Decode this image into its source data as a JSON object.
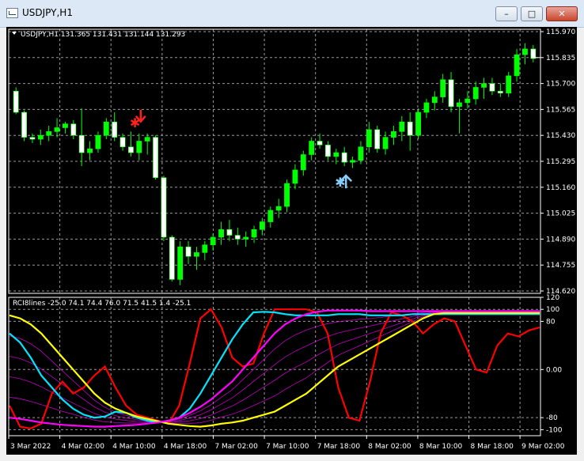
{
  "window": {
    "title": "USDJPY,H1",
    "minimize_icon": "minimize-icon",
    "maximize_icon": "maximize-icon",
    "close_icon": "close-icon"
  },
  "main_chart": {
    "header": "USDJPY,H1  131.365 131.431 131.144 131.293",
    "price_labels": [
      "115.970",
      "115.835",
      "115.700",
      "115.565",
      "115.430",
      "115.295",
      "115.160",
      "115.025",
      "114.890",
      "114.755",
      "114.620"
    ],
    "current_price": "115.835",
    "up_color": "#00ff00",
    "down_color": "#ffffff",
    "sell_arrow_color": "#ff2020",
    "buy_arrow_color": "#87cefa"
  },
  "sub_chart": {
    "header": "RCI8lines -25.0 74.1 74.4 76.0 71.5 41.5 1.4 -25.1",
    "level_labels": [
      "120",
      "100",
      "80",
      "0.00",
      "-80",
      "-100"
    ]
  },
  "time_labels": [
    "3 Mar 2022",
    "4 Mar 02:00",
    "4 Mar 10:00",
    "4 Mar 18:00",
    "7 Mar 02:00",
    "7 Mar 10:00",
    "7 Mar 18:00",
    "8 Mar 02:00",
    "8 Mar 10:00",
    "8 Mar 18:00",
    "9 Mar 02:00"
  ],
  "chart_data": {
    "type": "candlestick",
    "symbol": "USDJPY",
    "timeframe": "H1",
    "price_range": [
      114.62,
      115.97
    ],
    "candles": [
      [
        115.66,
        115.68,
        115.54,
        115.55
      ],
      [
        115.55,
        115.56,
        115.4,
        115.42
      ],
      [
        115.42,
        115.44,
        115.39,
        115.41
      ],
      [
        115.41,
        115.46,
        115.38,
        115.43
      ],
      [
        115.43,
        115.48,
        115.4,
        115.45
      ],
      [
        115.45,
        115.52,
        115.42,
        115.47
      ],
      [
        115.47,
        115.5,
        115.44,
        115.49
      ],
      [
        115.49,
        115.51,
        115.41,
        115.43
      ],
      [
        115.43,
        115.57,
        115.27,
        115.34
      ],
      [
        115.34,
        115.4,
        115.3,
        115.36
      ],
      [
        115.36,
        115.45,
        115.34,
        115.43
      ],
      [
        115.43,
        115.52,
        115.41,
        115.5
      ],
      [
        115.5,
        115.55,
        115.4,
        115.42
      ],
      [
        115.42,
        115.44,
        115.35,
        115.37
      ],
      [
        115.37,
        115.45,
        115.32,
        115.34
      ],
      [
        115.34,
        115.44,
        115.3,
        115.4
      ],
      [
        115.4,
        115.44,
        115.33,
        115.42
      ],
      [
        115.42,
        115.43,
        115.2,
        115.21
      ],
      [
        115.21,
        115.22,
        114.88,
        114.9
      ],
      [
        114.9,
        114.91,
        114.67,
        114.68
      ],
      [
        114.68,
        114.88,
        114.65,
        114.85
      ],
      [
        114.85,
        114.88,
        114.76,
        114.8
      ],
      [
        114.8,
        114.85,
        114.73,
        114.82
      ],
      [
        114.82,
        114.88,
        114.78,
        114.86
      ],
      [
        114.86,
        114.92,
        114.83,
        114.9
      ],
      [
        114.9,
        114.98,
        114.86,
        114.94
      ],
      [
        114.94,
        114.99,
        114.88,
        114.91
      ],
      [
        114.91,
        114.95,
        114.86,
        114.89
      ],
      [
        114.89,
        114.93,
        114.85,
        114.9
      ],
      [
        114.9,
        114.96,
        114.87,
        114.94
      ],
      [
        114.94,
        115.0,
        114.91,
        114.98
      ],
      [
        114.98,
        115.06,
        114.95,
        115.04
      ],
      [
        115.04,
        115.1,
        115.0,
        115.06
      ],
      [
        115.06,
        115.2,
        115.03,
        115.18
      ],
      [
        115.18,
        115.28,
        115.15,
        115.25
      ],
      [
        115.25,
        115.35,
        115.22,
        115.33
      ],
      [
        115.33,
        115.42,
        115.3,
        115.4
      ],
      [
        115.4,
        115.44,
        115.36,
        115.38
      ],
      [
        115.38,
        115.4,
        115.3,
        115.32
      ],
      [
        115.32,
        115.36,
        115.28,
        115.34
      ],
      [
        115.34,
        115.37,
        115.27,
        115.29
      ],
      [
        115.29,
        115.32,
        115.26,
        115.3
      ],
      [
        115.3,
        115.4,
        115.28,
        115.37
      ],
      [
        115.37,
        115.5,
        115.34,
        115.46
      ],
      [
        115.46,
        115.48,
        115.34,
        115.36
      ],
      [
        115.36,
        115.45,
        115.33,
        115.42
      ],
      [
        115.42,
        115.48,
        115.38,
        115.45
      ],
      [
        115.45,
        115.53,
        115.4,
        115.5
      ],
      [
        115.5,
        115.55,
        115.35,
        115.43
      ],
      [
        115.43,
        115.57,
        115.41,
        115.55
      ],
      [
        115.55,
        115.62,
        115.52,
        115.6
      ],
      [
        115.6,
        115.66,
        115.56,
        115.63
      ],
      [
        115.63,
        115.75,
        115.6,
        115.72
      ],
      [
        115.72,
        115.76,
        115.55,
        115.58
      ],
      [
        115.58,
        115.62,
        115.44,
        115.6
      ],
      [
        115.6,
        115.66,
        115.57,
        115.62
      ],
      [
        115.62,
        115.71,
        115.59,
        115.68
      ],
      [
        115.68,
        115.73,
        115.62,
        115.7
      ],
      [
        115.7,
        115.73,
        115.64,
        115.66
      ],
      [
        115.66,
        115.7,
        115.63,
        115.65
      ],
      [
        115.65,
        115.76,
        115.63,
        115.74
      ],
      [
        115.74,
        115.88,
        115.71,
        115.85
      ],
      [
        115.85,
        115.91,
        115.8,
        115.88
      ],
      [
        115.88,
        115.9,
        115.81,
        115.83
      ]
    ],
    "signals": [
      {
        "type": "sell",
        "candle_index": 15
      },
      {
        "type": "buy",
        "candle_index": 40
      }
    ],
    "indicator": {
      "name": "RCI8lines",
      "range": [
        -110,
        120
      ],
      "levels": [
        100,
        80,
        0,
        -80,
        -100
      ],
      "series": [
        {
          "color": "#ff0000",
          "values": [
            -60,
            -95,
            -98,
            -90,
            -40,
            -20,
            -40,
            -30,
            -10,
            5,
            -30,
            -60,
            -75,
            -80,
            -85,
            -90,
            -60,
            10,
            85,
            100,
            70,
            20,
            5,
            10,
            60,
            100,
            100,
            100,
            100,
            95,
            60,
            -30,
            -80,
            -85,
            -20,
            60,
            95,
            90,
            80,
            60,
            75,
            85,
            80,
            40,
            0,
            -5,
            40,
            60,
            55,
            65,
            70
          ]
        },
        {
          "color": "#00e5ff",
          "values": [
            60,
            45,
            20,
            -10,
            -30,
            -50,
            -65,
            -75,
            -80,
            -78,
            -70,
            -72,
            -80,
            -85,
            -88,
            -85,
            -80,
            -65,
            -40,
            -10,
            20,
            50,
            75,
            95,
            96,
            95,
            92,
            90,
            90,
            90,
            90,
            92,
            92,
            92,
            90,
            90,
            90,
            90,
            92,
            92,
            92,
            92,
            92,
            92,
            92,
            92,
            92,
            92,
            92,
            92,
            92
          ]
        },
        {
          "color": "#ffff00",
          "values": [
            90,
            85,
            75,
            60,
            40,
            20,
            0,
            -20,
            -40,
            -55,
            -65,
            -72,
            -78,
            -82,
            -86,
            -90,
            -92,
            -94,
            -95,
            -93,
            -90,
            -88,
            -85,
            -80,
            -75,
            -70,
            -60,
            -50,
            -40,
            -25,
            -10,
            5,
            15,
            25,
            35,
            45,
            55,
            65,
            75,
            85,
            92,
            94,
            94,
            94,
            94,
            94,
            94,
            94,
            94,
            94,
            94
          ]
        },
        {
          "color": "#ff00ff",
          "values": [
            -80,
            -82,
            -85,
            -88,
            -90,
            -92,
            -93,
            -94,
            -95,
            -95,
            -94,
            -93,
            -92,
            -90,
            -88,
            -85,
            -80,
            -72,
            -62,
            -50,
            -35,
            -20,
            0,
            20,
            40,
            60,
            75,
            85,
            92,
            96,
            98,
            98,
            98,
            98,
            97,
            97,
            97,
            97,
            97,
            97,
            97,
            97,
            97,
            97,
            97,
            97,
            97,
            97,
            97,
            97,
            97
          ]
        }
      ]
    }
  }
}
